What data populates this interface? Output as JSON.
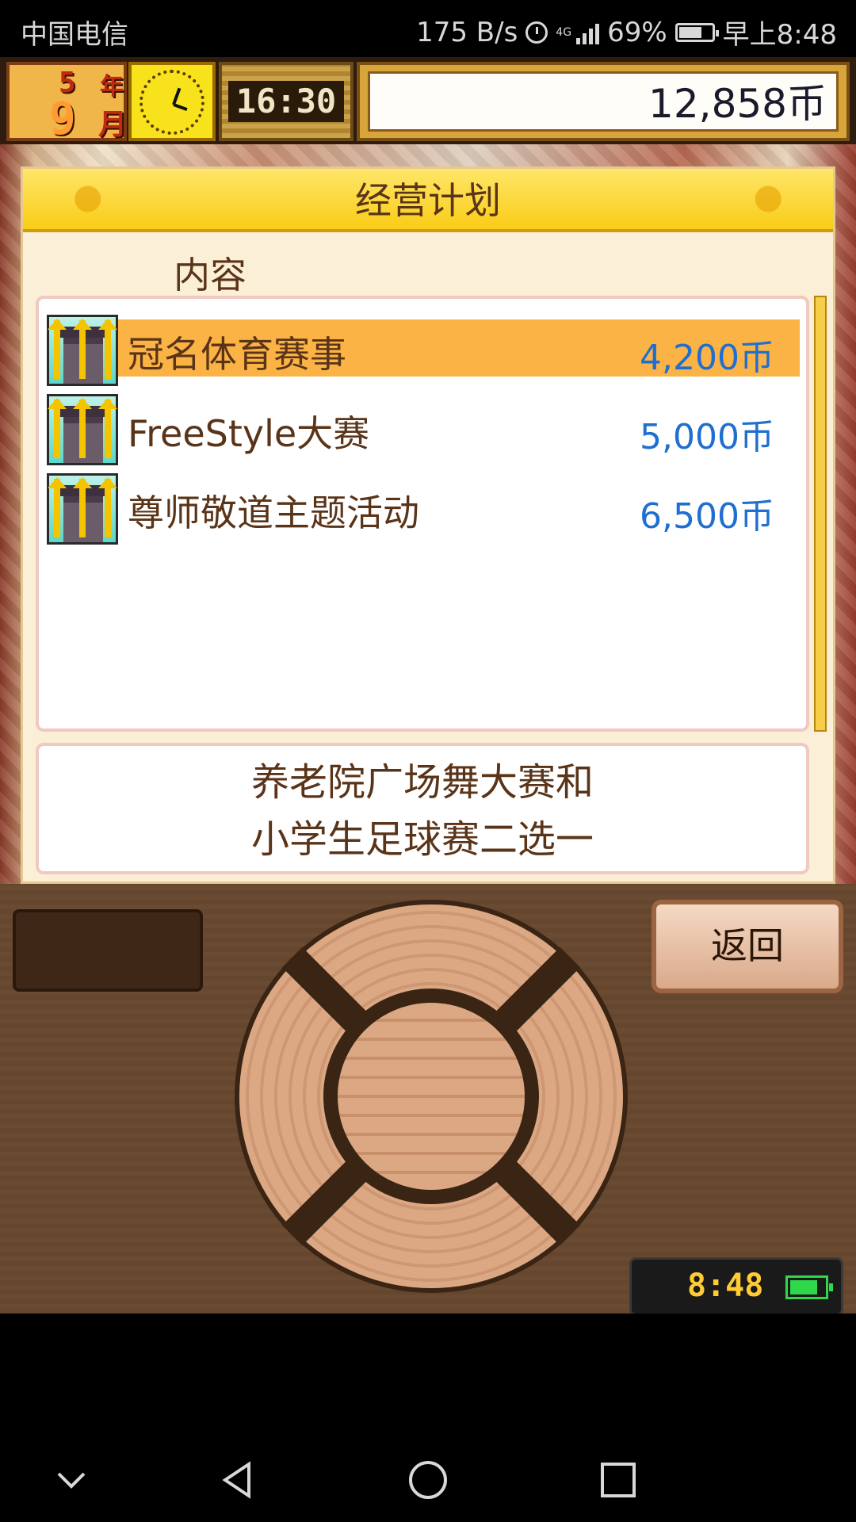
{
  "status_bar": {
    "carrier": "中国电信",
    "net_speed": "175 B/s",
    "net_type": "4G",
    "battery_pct": "69%",
    "time": "早上8:48",
    "icons": [
      "alarm-icon",
      "signal-icon",
      "battery-icon"
    ]
  },
  "hud": {
    "year_num": "5",
    "year_unit": "年",
    "month_num": "9",
    "month_unit": "月",
    "game_time": "16:30",
    "money": "12,858币"
  },
  "dialog": {
    "title": "经营计划",
    "column_header": "内容",
    "items": [
      {
        "name": "冠名体育赛事",
        "price": "4,200币",
        "selected": true,
        "icon": "building-upgrade-icon"
      },
      {
        "name": "FreeStyle大赛",
        "price": "5,000币",
        "selected": false,
        "icon": "building-upgrade-icon"
      },
      {
        "name": "尊师敬道主题活动",
        "price": "6,500币",
        "selected": false,
        "icon": "building-upgrade-icon"
      }
    ],
    "description_line1": "养老院广场舞大赛和",
    "description_line2": "小学生足球赛二选一"
  },
  "controls": {
    "back_label": "返回",
    "device_time": "8:48"
  },
  "colors": {
    "selected_row": "#fbb345",
    "price": "#1f6fd1",
    "text_brown": "#5a3418",
    "header_yellow": "#f9cc16"
  }
}
